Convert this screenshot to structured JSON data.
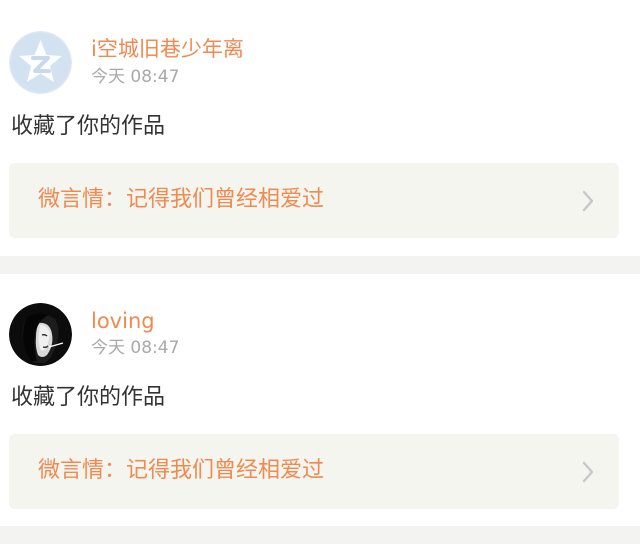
{
  "notifications": [
    {
      "username": "i空城旧巷少年离",
      "time": "今天 08:47",
      "action": "收藏了你的作品",
      "work_title": "微言情：记得我们曾经相爱过",
      "avatar": "qzone-default-avatar"
    },
    {
      "username": "loving",
      "time": "今天 08:47",
      "action": "收藏了你的作品",
      "work_title": "微言情：记得我们曾经相爱过",
      "avatar": "user-photo-avatar"
    }
  ],
  "colors": {
    "accent": "#f08a50",
    "time_text": "#a9a9a9",
    "body_text": "#333333",
    "card_bg": "#f5f5ef",
    "separator_bg": "#f3f3f1"
  },
  "icons": {
    "chevron": "chevron-right-icon"
  }
}
